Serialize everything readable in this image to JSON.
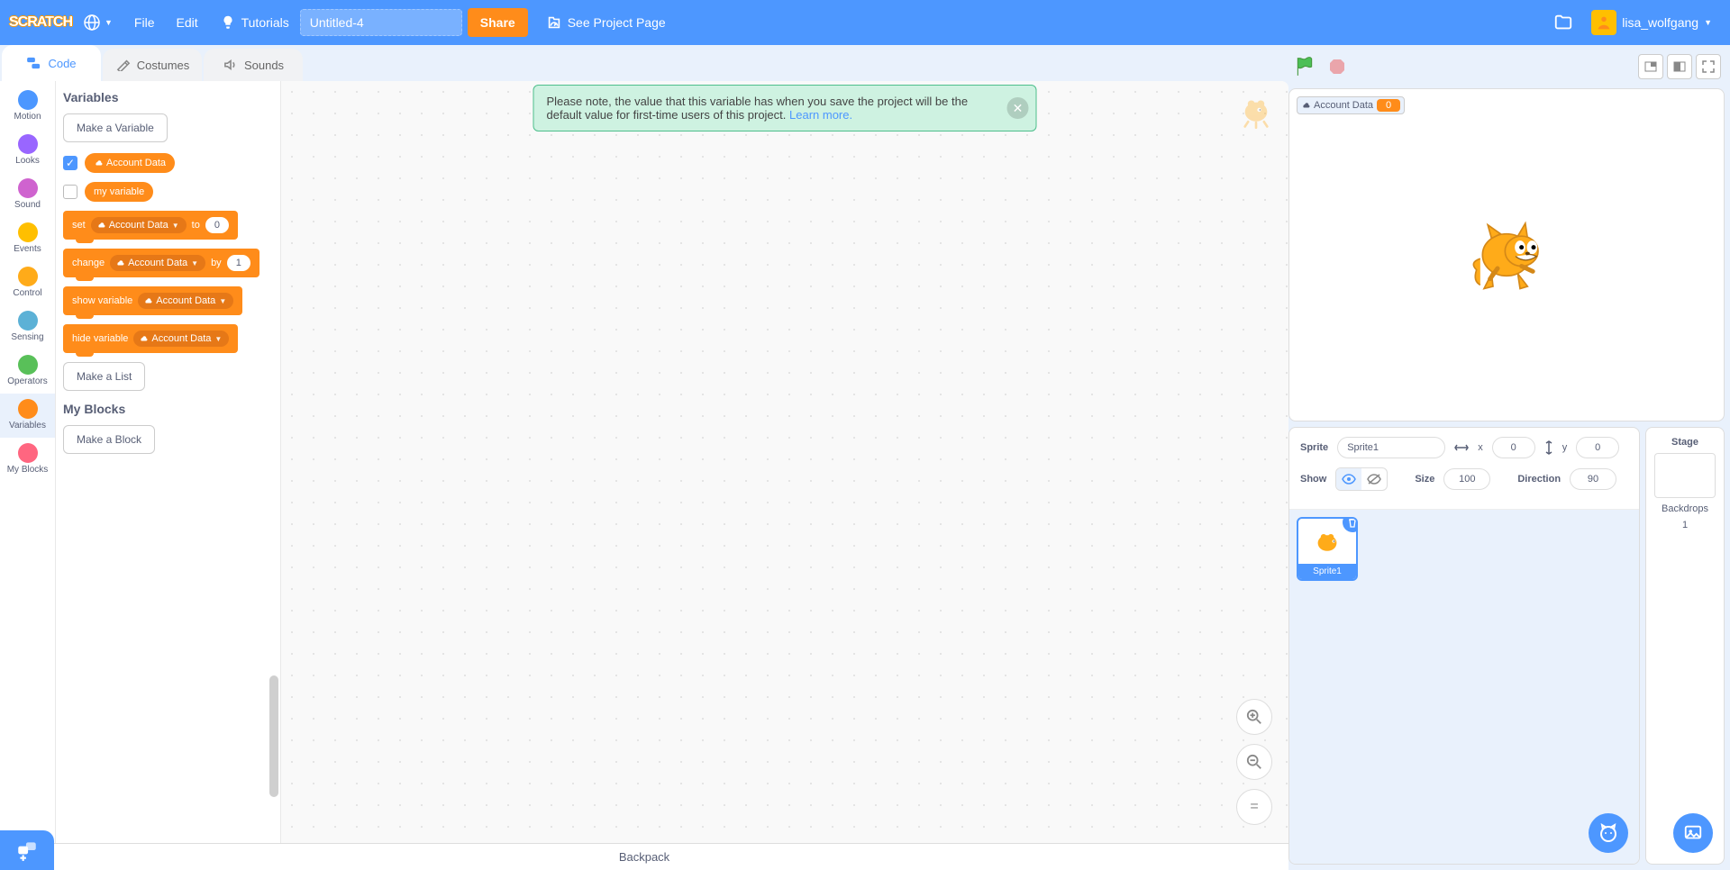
{
  "menu": {
    "logo": "SCRATCH",
    "file": "File",
    "edit": "Edit",
    "tutorials": "Tutorials",
    "title": "Untitled-4",
    "share": "Share",
    "see_project": "See Project Page",
    "username": "lisa_wolfgang"
  },
  "tabs": {
    "code": "Code",
    "costumes": "Costumes",
    "sounds": "Sounds"
  },
  "categories": [
    {
      "name": "Motion",
      "color": "#4c97ff"
    },
    {
      "name": "Looks",
      "color": "#9966ff"
    },
    {
      "name": "Sound",
      "color": "#cf63cf"
    },
    {
      "name": "Events",
      "color": "#ffbf00"
    },
    {
      "name": "Control",
      "color": "#ffab19"
    },
    {
      "name": "Sensing",
      "color": "#5cb1d6"
    },
    {
      "name": "Operators",
      "color": "#59c059"
    },
    {
      "name": "Variables",
      "color": "#ff8c1a"
    },
    {
      "name": "My Blocks",
      "color": "#ff6680"
    }
  ],
  "palette": {
    "h_variables": "Variables",
    "make_variable": "Make a Variable",
    "var1": {
      "name": "Account Data",
      "checked": true,
      "cloud": true
    },
    "var2": {
      "name": "my variable",
      "checked": false,
      "cloud": false
    },
    "set": {
      "label": "set",
      "to": "to",
      "var": "Account Data",
      "val": "0"
    },
    "change": {
      "label": "change",
      "by": "by",
      "var": "Account Data",
      "val": "1"
    },
    "show": {
      "label": "show variable",
      "var": "Account Data"
    },
    "hide": {
      "label": "hide variable",
      "var": "Account Data"
    },
    "make_list": "Make a List",
    "h_myblocks": "My Blocks",
    "make_block": "Make a Block"
  },
  "alert": {
    "text": "Please note, the value that this variable has when you save the project will be the default value for first-time users of this project. ",
    "link": "Learn more."
  },
  "stage": {
    "monitor_label": "Account Data",
    "monitor_value": "0"
  },
  "sprite": {
    "label": "Sprite",
    "name": "Sprite1",
    "x_lbl": "x",
    "x_val": "0",
    "y_lbl": "y",
    "y_val": "0",
    "show_lbl": "Show",
    "size_lbl": "Size",
    "size_val": "100",
    "dir_lbl": "Direction",
    "dir_val": "90",
    "tile_name": "Sprite1"
  },
  "stage_sel": {
    "title": "Stage",
    "back_lbl": "Backdrops",
    "back_count": "1"
  },
  "backpack": "Backpack"
}
